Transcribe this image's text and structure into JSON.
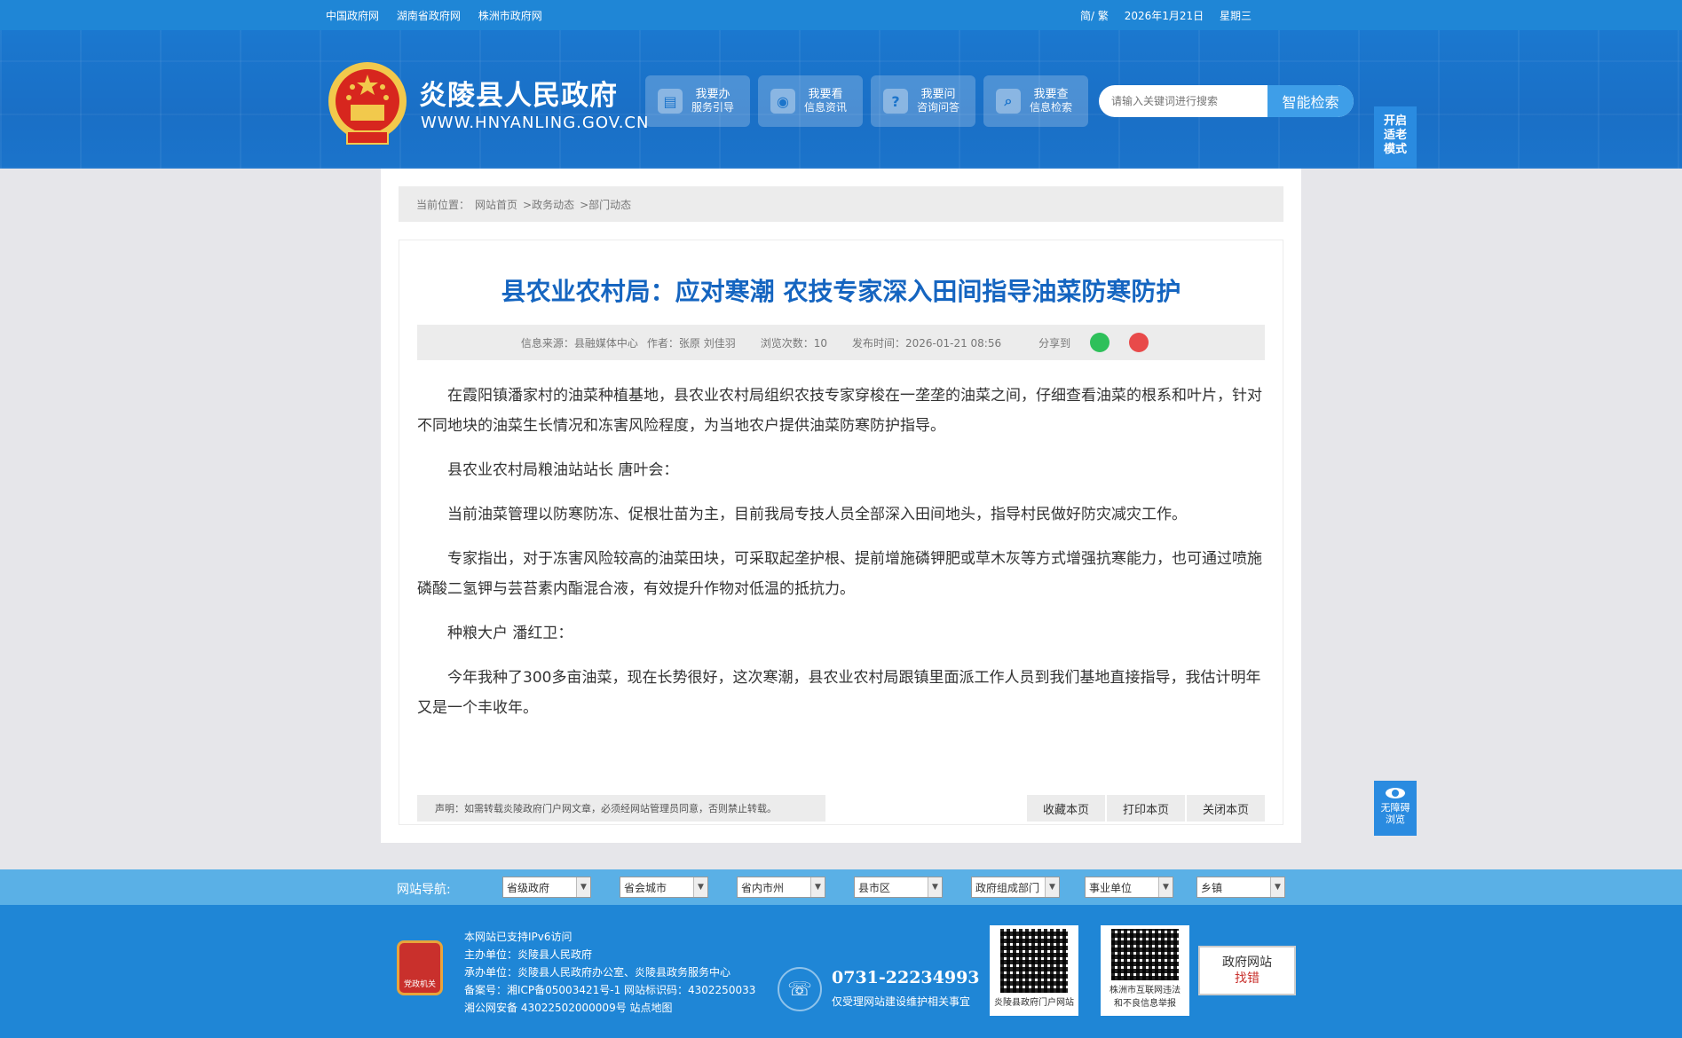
{
  "topbar": {
    "links": [
      "中国政府网",
      "湖南省政府网",
      "株洲市政府网"
    ],
    "lang": "简/ 繁",
    "date": "2026年1月21日",
    "weekday": "星期三"
  },
  "header": {
    "site_title": "炎陵县人民政府",
    "site_url": "WWW.HNYANLING.GOV.CN",
    "services": [
      {
        "title": "我要办",
        "sub": "服务引导",
        "icon": "document-icon"
      },
      {
        "title": "我要看",
        "sub": "信息资讯",
        "icon": "eye-icon"
      },
      {
        "title": "我要问",
        "sub": "咨询问答",
        "icon": "question-icon"
      },
      {
        "title": "我要查",
        "sub": "信息检索",
        "icon": "search-icon"
      }
    ],
    "search_placeholder": "请输入关键词进行搜索",
    "search_button": "智能检索",
    "elder_mode": "开启适老模式",
    "accessibility": "无障碍浏览"
  },
  "breadcrumb": {
    "label": "当前位置：",
    "items": [
      "网站首页",
      ">政务动态",
      ">部门动态"
    ]
  },
  "article": {
    "title": "县农业农村局：应对寒潮 农技专家深入田间指导油菜防寒防护",
    "meta": {
      "source": "信息来源：县融媒体中心",
      "author": "作者：张原 刘佳羽",
      "views": "浏览次数：10",
      "time": "发布时间：2026-01-21 08:56",
      "share": "分享到"
    },
    "paragraphs": [
      "在霞阳镇潘家村的油菜种植基地，县农业农村局组织农技专家穿梭在一垄垄的油菜之间，仔细查看油菜的根系和叶片，针对不同地块的油菜生长情况和冻害风险程度，为当地农户提供油菜防寒防护指导。",
      "县农业农村局粮油站站长 唐叶会：",
      "当前油菜管理以防寒防冻、促根壮苗为主，目前我局专技人员全部深入田间地头，指导村民做好防灾减灾工作。",
      "专家指出，对于冻害风险较高的油菜田块，可采取起垄护根、提前增施磷钾肥或草木灰等方式增强抗寒能力，也可通过喷施磷酸二氢钾与芸苔素内酯混合液，有效提升作物对低温的抵抗力。",
      "种粮大户 潘红卫：",
      "今年我种了300多亩油菜，现在长势很好，这次寒潮，县农业农村局跟镇里面派工作人员到我们基地直接指导，我估计明年又是一个丰收年。"
    ],
    "declaration": "声明：如需转载炎陵政府门户网文章，必须经网站管理员同意，否则禁止转载。",
    "actions": [
      "收藏本页",
      "打印本页",
      "关闭本页"
    ]
  },
  "site_nav": {
    "label": "网站导航:",
    "selects": [
      "省级政府",
      "省会城市",
      "省内市州",
      "县市区",
      "政府组成部门",
      "事业单位",
      "乡镇"
    ]
  },
  "footer": {
    "badge": "党政机关",
    "lines": [
      "本网站已支持IPv6访问",
      "主办单位：炎陵县人民政府",
      "承办单位：炎陵县人民政府办公室、炎陵县政务服务中心",
      "备案号：湘ICP备05003421号-1 网站标识码：4302250033",
      "湘公网安备 43022502000009号 站点地图"
    ],
    "phone": "0731-22234993",
    "phone_note": "仅受理网站建设维护相关事宜",
    "qr1_caption": "炎陵县政府门户网站",
    "qr2_caption": "株洲市互联网违法和不良信息举报",
    "jiucuo_line1": "政府网站",
    "jiucuo_line2": "找错"
  }
}
